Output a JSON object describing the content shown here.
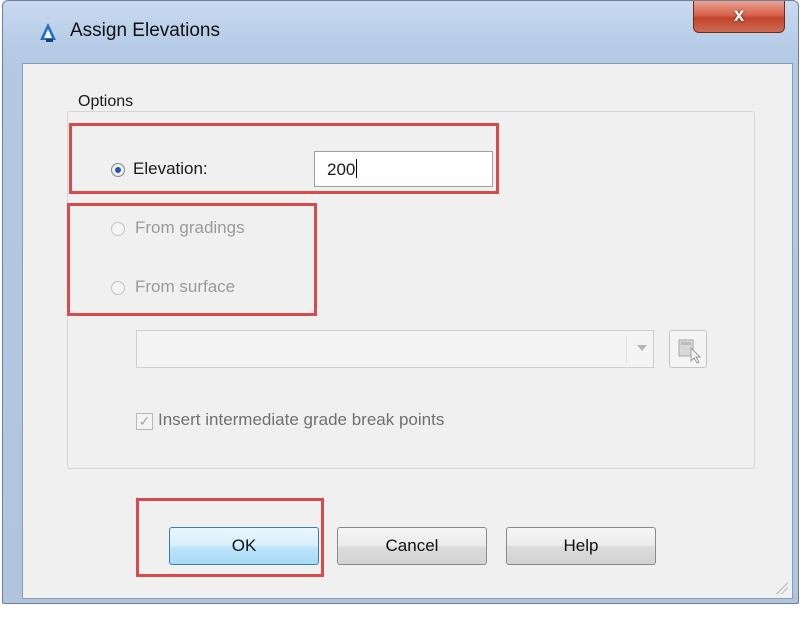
{
  "window": {
    "title": "Assign Elevations",
    "close_glyph": "x"
  },
  "options": {
    "group_label": "Options",
    "elevation_label": "Elevation:",
    "elevation_value": "200",
    "from_gradings_label": "From gradings",
    "from_surface_label": "From surface",
    "surface_select_value": "",
    "insert_breakpoints_label": "Insert intermediate grade break points",
    "insert_breakpoints_checked": true
  },
  "buttons": {
    "ok": "OK",
    "cancel": "Cancel",
    "help": "Help"
  },
  "colors": {
    "highlight": "#d94b4b",
    "radio_selected": "#1c5ca8"
  }
}
